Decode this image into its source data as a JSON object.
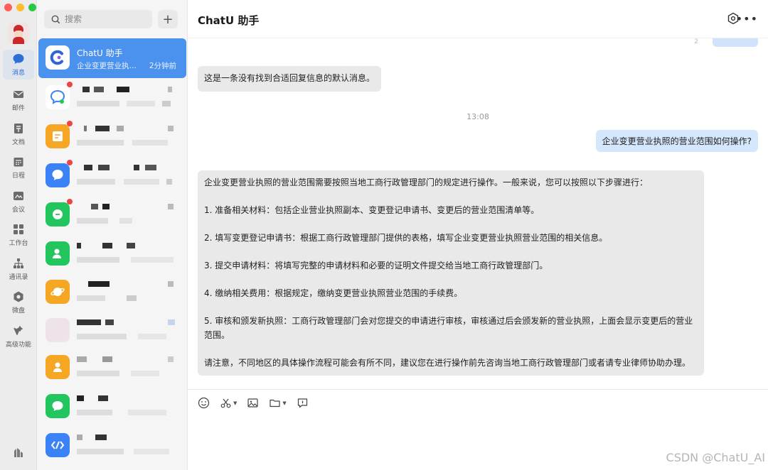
{
  "rail": {
    "items": [
      {
        "label": "消息",
        "icon": "chat-bubble-icon"
      },
      {
        "label": "邮件",
        "icon": "mail-icon"
      },
      {
        "label": "文档",
        "icon": "document-icon"
      },
      {
        "label": "日程",
        "icon": "calendar-icon"
      },
      {
        "label": "会议",
        "icon": "meeting-icon"
      },
      {
        "label": "工作台",
        "icon": "grid-icon"
      },
      {
        "label": "通讯录",
        "icon": "contacts-icon"
      },
      {
        "label": "微盘",
        "icon": "drive-icon"
      },
      {
        "label": "高级功能",
        "icon": "sparkle-icon"
      }
    ]
  },
  "list": {
    "search_placeholder": "搜索",
    "add_label": "+",
    "active_conversation": {
      "name": "ChatU 助手",
      "preview": "企业变更营业执照的营业范围如何操作?",
      "time": "2分钟前"
    }
  },
  "chat": {
    "title": "ChatU 助手",
    "partial_number": "2",
    "default_message": "这是一条没有找到合适回复信息的默认消息。",
    "timestamp": "13:08",
    "user_question": "企业变更营业执照的营业范围如何操作?",
    "answer": [
      "企业变更营业执照的营业范围需要按照当地工商行政管理部门的规定进行操作。一般来说，您可以按照以下步骤进行：",
      "1. 准备相关材料：包括企业营业执照副本、变更登记申请书、变更后的营业范围清单等。",
      "2. 填写变更登记申请书：根据工商行政管理部门提供的表格，填写企业变更营业执照营业范围的相关信息。",
      "3. 提交申请材料：将填写完整的申请材料和必要的证明文件提交给当地工商行政管理部门。",
      "4. 缴纳相关费用：根据规定，缴纳变更营业执照营业范围的手续费。",
      "5. 审核和颁发新执照：工商行政管理部门会对您提交的申请进行审核，审核通过后会颁发新的营业执照，上面会显示变更后的营业范围。",
      "请注意，不同地区的具体操作流程可能会有所不同，建议您在进行操作前先咨询当地工商行政管理部门或者请专业律师协助办理。"
    ]
  },
  "watermark": "CSDN @ChatU_AI",
  "colors": {
    "accent": "#4a92ee",
    "user_bubble": "#d4e7fd",
    "bot_bubble": "#e9e9e9",
    "unread_dot": "#ef4444"
  }
}
